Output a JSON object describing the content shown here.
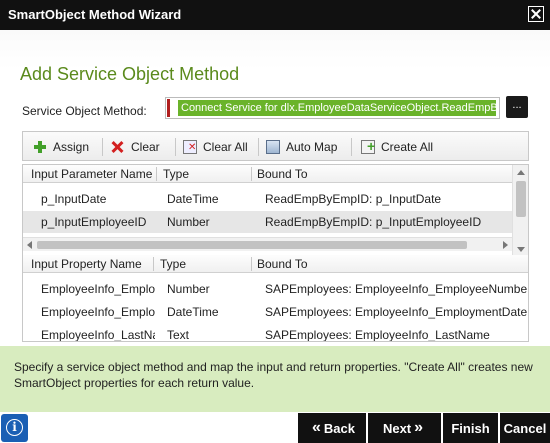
{
  "window": {
    "title": "SmartObject Method Wizard",
    "close_icon": "close-icon"
  },
  "heading": "Add Service Object Method",
  "service_object_method": {
    "label": "Service Object Method:",
    "value": "Connect Service for dlx.EmployeeDataServiceObject.ReadEmpByEmpID",
    "browse_label": "..."
  },
  "toolbar": {
    "assign": {
      "label": "Assign",
      "icon": "plus-icon"
    },
    "clear": {
      "label": "Clear",
      "icon": "x-icon"
    },
    "clear_all": {
      "label": "Clear All",
      "icon": "clear-all-icon"
    },
    "auto_map": {
      "label": "Auto Map",
      "icon": "auto-map-icon"
    },
    "create_all": {
      "label": "Create All",
      "icon": "create-all-icon"
    }
  },
  "input_parameters": {
    "headers": [
      "Input Parameter Name",
      "Type",
      "Bound To"
    ],
    "rows": [
      [
        "p_InputDate",
        "DateTime",
        "ReadEmpByEmpID: p_InputDate"
      ],
      [
        "p_InputEmployeeID",
        "Number",
        "ReadEmpByEmpID: p_InputEmployeeID"
      ]
    ]
  },
  "input_properties": {
    "headers": [
      "Input Property Name",
      "Type",
      "Bound To"
    ],
    "rows": [
      [
        "EmployeeInfo_EmployeeNumber",
        "Number",
        "SAPEmployees: EmployeeInfo_EmployeeNumber"
      ],
      [
        "EmployeeInfo_EmploymentDate",
        "DateTime",
        "SAPEmployees: EmployeeInfo_EmploymentDate"
      ],
      [
        "EmployeeInfo_LastName",
        "Text",
        "SAPEmployees: EmployeeInfo_LastName"
      ]
    ]
  },
  "info_message": "Specify a service object method and map the input and return properties. \"Create All\" creates new SmartObject properties for each return value.",
  "footer": {
    "info_icon": "info-icon",
    "info_glyph": "i",
    "back_label": "Back",
    "next_label": "Next",
    "finish_label": "Finish",
    "cancel_label": "Cancel"
  },
  "colors": {
    "title_bar": "#111111",
    "heading_green": "#5a8a1c",
    "selected_field_green": "#6ab32a",
    "info_bar": "#d8ecbf",
    "info_button_blue": "#1a5fb4"
  }
}
